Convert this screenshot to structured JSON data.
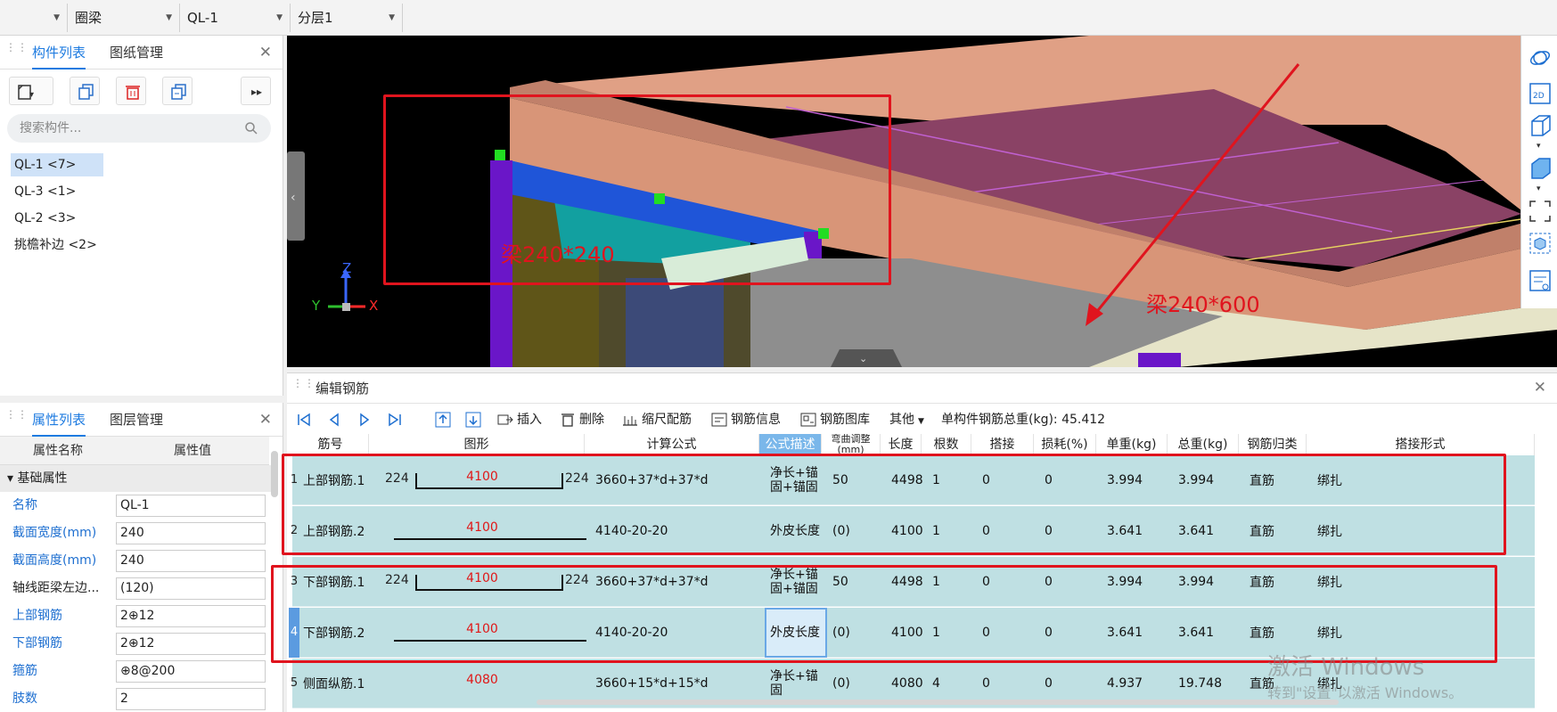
{
  "toolbar": {
    "cat": "圈梁",
    "comp": "QL-1",
    "layer": "分层1"
  },
  "component_panel": {
    "tab_components": "构件列表",
    "tab_drawings": "图纸管理",
    "search_placeholder": "搜索构件...",
    "items": [
      {
        "label": "QL-1 <7>"
      },
      {
        "label": "QL-3 <1>"
      },
      {
        "label": "QL-2 <3>"
      },
      {
        "label": "挑檐补边 <2>"
      }
    ]
  },
  "property_panel": {
    "tab_props": "属性列表",
    "tab_layers": "图层管理",
    "col_name": "属性名称",
    "col_value": "属性值",
    "group": "基础属性",
    "rows": [
      {
        "name": "名称",
        "value": "QL-1"
      },
      {
        "name": "截面宽度(mm)",
        "value": "240"
      },
      {
        "name": "截面高度(mm)",
        "value": "240"
      },
      {
        "name": "轴线距梁左边...",
        "value": "(120)"
      },
      {
        "name": "上部钢筋",
        "value": "2⊕12"
      },
      {
        "name": "下部钢筋",
        "value": "2⊕12"
      },
      {
        "name": "箍筋",
        "value": "⊕8@200"
      },
      {
        "name": "肢数",
        "value": "2"
      }
    ]
  },
  "viewport": {
    "label_small_beam": "梁240*240",
    "label_big_beam": "梁240*600",
    "axis_z": "Z",
    "axis_y": "Y",
    "axis_x": "X",
    "view_2d": "2D"
  },
  "editor": {
    "title": "编辑钢筋",
    "tools": {
      "insert": "插入",
      "delete": "删除",
      "scale": "缩尺配筋",
      "info": "钢筋信息",
      "library": "钢筋图库",
      "other": "其他",
      "total": "单构件钢筋总重(kg): 45.412"
    },
    "columns": [
      "筋号",
      "图形",
      "计算公式",
      "公式描述",
      "弯曲调整(mm)",
      "长度",
      "根数",
      "搭接",
      "损耗(%)",
      "单重(kg)",
      "总重(kg)",
      "钢筋归类",
      "搭接形式"
    ],
    "rows": [
      {
        "num": "1",
        "name": "上部钢筋.1",
        "left": "224",
        "len": "4100",
        "right": "224",
        "formula": "3660+37*d+37*d",
        "desc": "净长+锚固+锚固",
        "bend": "50",
        "length": "4498",
        "count": "1",
        "lap": "0",
        "loss": "0",
        "unit_w": "3.994",
        "total_w": "3.994",
        "cls": "直筋",
        "lap_type": "绑扎",
        "hooked": true
      },
      {
        "num": "2",
        "name": "上部钢筋.2",
        "left": "",
        "len": "4100",
        "right": "",
        "formula": "4140-20-20",
        "desc": "外皮长度",
        "bend": "(0)",
        "length": "4100",
        "count": "1",
        "lap": "0",
        "loss": "0",
        "unit_w": "3.641",
        "total_w": "3.641",
        "cls": "直筋",
        "lap_type": "绑扎",
        "hooked": false
      },
      {
        "num": "3",
        "name": "下部钢筋.1",
        "left": "224",
        "len": "4100",
        "right": "224",
        "formula": "3660+37*d+37*d",
        "desc": "净长+锚固+锚固",
        "bend": "50",
        "length": "4498",
        "count": "1",
        "lap": "0",
        "loss": "0",
        "unit_w": "3.994",
        "total_w": "3.994",
        "cls": "直筋",
        "lap_type": "绑扎",
        "hooked": true
      },
      {
        "num": "4",
        "name": "下部钢筋.2",
        "left": "",
        "len": "4100",
        "right": "",
        "formula": "4140-20-20",
        "desc": "外皮长度",
        "bend": "(0)",
        "length": "4100",
        "count": "1",
        "lap": "0",
        "loss": "0",
        "unit_w": "3.641",
        "total_w": "3.641",
        "cls": "直筋",
        "lap_type": "绑扎",
        "hooked": false
      },
      {
        "num": "5",
        "name": "侧面纵筋.1",
        "left": "",
        "len": "4080",
        "right": "",
        "formula": "3660+15*d+15*d",
        "desc": "净长+锚固",
        "bend": "(0)",
        "length": "4080",
        "count": "4",
        "lap": "0",
        "loss": "0",
        "unit_w": "4.937",
        "total_w": "19.748",
        "cls": "直筋",
        "lap_type": "绑扎",
        "hooked": false
      }
    ]
  },
  "watermark": {
    "line1": "激活 Windows",
    "line2": "转到\"设置\"以激活 Windows。"
  }
}
